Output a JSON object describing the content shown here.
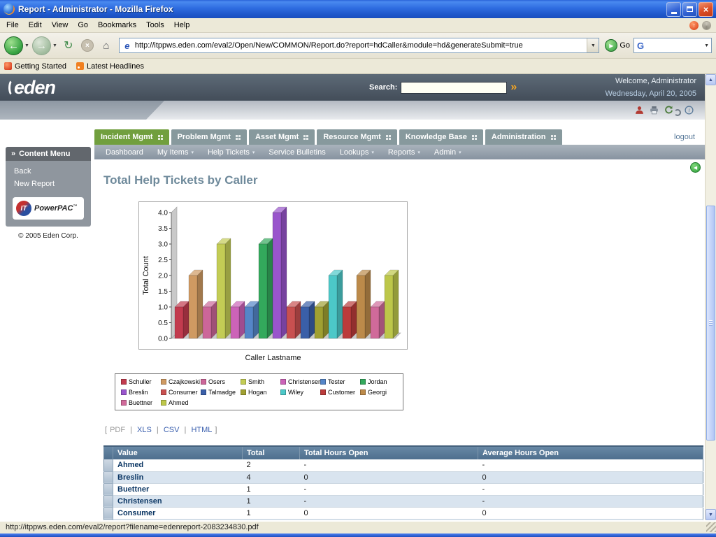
{
  "window": {
    "title": "Report - Administrator - Mozilla Firefox"
  },
  "menubar": {
    "items": [
      "File",
      "Edit",
      "View",
      "Go",
      "Bookmarks",
      "Tools",
      "Help"
    ]
  },
  "navbar": {
    "url": "http://itppws.eden.com/eval2/Open/New/COMMON/Report.do?report=hdCaller&module=hd&generateSubmit=true",
    "favicon_letter": "e",
    "go_label": "Go",
    "search_engine_initial": "G",
    "search_value": ""
  },
  "bookmarks": {
    "items": [
      "Getting Started",
      "Latest Headlines"
    ]
  },
  "site": {
    "logo": "eden",
    "search_label": "Search:",
    "search_value": "",
    "search_button": "»",
    "welcome": "Welcome, Administrator",
    "date": "Wednesday, April 20, 2005",
    "tabs": [
      {
        "label": "Incident Mgmt",
        "active": true
      },
      {
        "label": "Problem Mgmt",
        "active": false
      },
      {
        "label": "Asset Mgmt",
        "active": false
      },
      {
        "label": "Resource Mgmt",
        "active": false
      },
      {
        "label": "Knowledge Base",
        "active": false
      },
      {
        "label": "Administration",
        "active": false
      }
    ],
    "logout": "logout",
    "menu_caret": "▾",
    "menu": [
      {
        "label": "Dashboard",
        "dropdown": false
      },
      {
        "label": "My Items",
        "dropdown": true
      },
      {
        "label": "Help Tickets",
        "dropdown": true
      },
      {
        "label": "Service Bulletins",
        "dropdown": false
      },
      {
        "label": "Lookups",
        "dropdown": true
      },
      {
        "label": "Reports",
        "dropdown": true
      },
      {
        "label": "Admin",
        "dropdown": true
      }
    ],
    "sidebar": {
      "header_prefix": "»",
      "header": "Content Menu",
      "items": [
        "Back",
        "New Report"
      ],
      "logo_it": "IT",
      "logo_text": "PowerPAC",
      "logo_tm": "™",
      "copyright": "© 2005 Eden Corp."
    }
  },
  "report": {
    "title": "Total Help Tickets by Caller",
    "export": {
      "prefix": "[",
      "separator": "|",
      "suffix": "]",
      "links": [
        {
          "label": "PDF",
          "enabled": false
        },
        {
          "label": "XLS",
          "enabled": true
        },
        {
          "label": "CSV",
          "enabled": true
        },
        {
          "label": "HTML",
          "enabled": true
        }
      ]
    },
    "table": {
      "headers": [
        "Value",
        "Total",
        "Total Hours Open",
        "Average Hours Open"
      ],
      "rows": [
        {
          "value": "Ahmed",
          "total": "2",
          "total_hours": "-",
          "avg_hours": "-"
        },
        {
          "value": "Breslin",
          "total": "4",
          "total_hours": "0",
          "avg_hours": "0"
        },
        {
          "value": "Buettner",
          "total": "1",
          "total_hours": "-",
          "avg_hours": "-"
        },
        {
          "value": "Christensen",
          "total": "1",
          "total_hours": "-",
          "avg_hours": "-"
        },
        {
          "value": "Consumer",
          "total": "1",
          "total_hours": "0",
          "avg_hours": "0"
        }
      ]
    }
  },
  "chart_data": {
    "type": "bar",
    "style": "3d-bar",
    "title": "Total Help Tickets by Caller",
    "xlabel": "Caller Lastname",
    "ylabel": "Total Count",
    "ylim": [
      0,
      4.0
    ],
    "ytick_step": 0.5,
    "grid": false,
    "legend_position": "bottom",
    "categories": [
      "Schuller",
      "Czajkowski",
      "Osers",
      "Smith",
      "Christensen",
      "Tester",
      "Jordan",
      "Breslin",
      "Consumer",
      "Talmadge",
      "Hogan",
      "Wiley",
      "Customer",
      "Georgi",
      "Buettner",
      "Ahmed"
    ],
    "values": [
      1,
      2,
      1,
      3,
      1,
      1,
      3,
      4,
      1,
      1,
      1,
      2,
      1,
      2,
      1,
      2
    ],
    "colors": [
      "#c23b4e",
      "#cf9a62",
      "#cc6699",
      "#c3cc55",
      "#cc63b8",
      "#5586c8",
      "#33a95c",
      "#9955cc",
      "#c85050",
      "#3a5fa8",
      "#a0a032",
      "#4cc8c8",
      "#bb3b3b",
      "#bc8a4a",
      "#d06a9a",
      "#bdc74a"
    ]
  },
  "statusbar": {
    "text": "http://itppws.eden.com/eval2/report?filename=edenreport-2083234830.pdf"
  }
}
